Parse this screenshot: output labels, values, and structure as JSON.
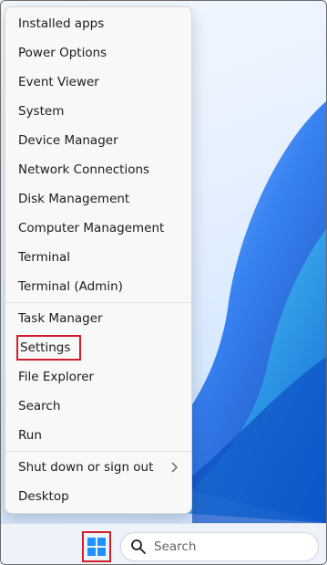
{
  "context_menu": {
    "items": [
      {
        "label": "Installed apps"
      },
      {
        "label": "Power Options"
      },
      {
        "label": "Event Viewer"
      },
      {
        "label": "System"
      },
      {
        "label": "Device Manager"
      },
      {
        "label": "Network Connections"
      },
      {
        "label": "Disk Management"
      },
      {
        "label": "Computer Management"
      },
      {
        "label": "Terminal"
      },
      {
        "label": "Terminal (Admin)"
      },
      {
        "label": "Task Manager"
      },
      {
        "label": "Settings",
        "highlighted": true
      },
      {
        "label": "File Explorer"
      },
      {
        "label": "Search"
      },
      {
        "label": "Run"
      },
      {
        "label": "Shut down or sign out",
        "has_submenu": true
      },
      {
        "label": "Desktop"
      }
    ]
  },
  "taskbar": {
    "start_icon": "windows-logo-icon",
    "search_icon": "search-icon",
    "search_placeholder": "Search"
  },
  "colors": {
    "highlight_border": "#d21d2b",
    "windows_blue": "#1e90ff"
  }
}
